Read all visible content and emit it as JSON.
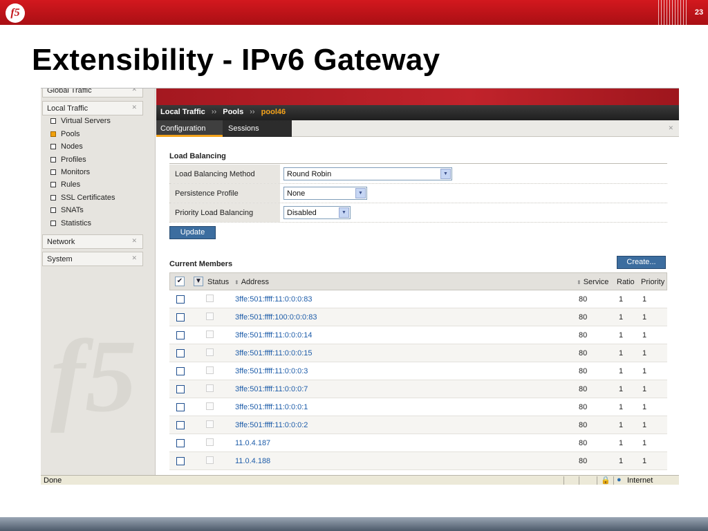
{
  "slide": {
    "logo": "f5",
    "number": "23",
    "title": "Extensibility - IPv6 Gateway"
  },
  "sidebar": {
    "sections": [
      {
        "label": "Global Traffic"
      },
      {
        "label": "Local Traffic"
      },
      {
        "label": "Network"
      },
      {
        "label": "System"
      }
    ],
    "local_traffic_items": [
      {
        "label": "Virtual Servers"
      },
      {
        "label": "Pools"
      },
      {
        "label": "Nodes"
      },
      {
        "label": "Profiles"
      },
      {
        "label": "Monitors"
      },
      {
        "label": "Rules"
      },
      {
        "label": "SSL Certificates"
      },
      {
        "label": "SNATs"
      },
      {
        "label": "Statistics"
      }
    ],
    "active_item": "Pools",
    "watermark": "f5"
  },
  "breadcrumb": {
    "items": [
      "Local Traffic",
      "Pools"
    ],
    "current": "pool46",
    "separator": "››"
  },
  "tabs": [
    {
      "label": "Configuration",
      "active": true
    },
    {
      "label": "Sessions",
      "active": false
    }
  ],
  "load_balancing": {
    "title": "Load Balancing",
    "fields": [
      {
        "label": "Load Balancing Method",
        "value": "Round Robin"
      },
      {
        "label": "Persistence Profile",
        "value": "None"
      },
      {
        "label": "Priority Load Balancing",
        "value": "Disabled"
      }
    ],
    "update_label": "Update"
  },
  "members": {
    "title": "Current Members",
    "create_label": "Create...",
    "columns": {
      "status": "Status",
      "address": "Address",
      "service": "Service",
      "ratio": "Ratio",
      "priority": "Priority"
    },
    "rows": [
      {
        "address": "3ffe:501:ffff:11:0:0:0:83",
        "service": "80",
        "ratio": "1",
        "priority": "1"
      },
      {
        "address": "3ffe:501:ffff:100:0:0:0:83",
        "service": "80",
        "ratio": "1",
        "priority": "1"
      },
      {
        "address": "3ffe:501:ffff:11:0:0:0:14",
        "service": "80",
        "ratio": "1",
        "priority": "1"
      },
      {
        "address": "3ffe:501:ffff:11:0:0:0:15",
        "service": "80",
        "ratio": "1",
        "priority": "1"
      },
      {
        "address": "3ffe:501:ffff:11:0:0:0:3",
        "service": "80",
        "ratio": "1",
        "priority": "1"
      },
      {
        "address": "3ffe:501:ffff:11:0:0:0:7",
        "service": "80",
        "ratio": "1",
        "priority": "1"
      },
      {
        "address": "3ffe:501:ffff:11:0:0:0:1",
        "service": "80",
        "ratio": "1",
        "priority": "1"
      },
      {
        "address": "3ffe:501:ffff:11:0:0:0:2",
        "service": "80",
        "ratio": "1",
        "priority": "1"
      },
      {
        "address": "11.0.4.187",
        "service": "80",
        "ratio": "1",
        "priority": "1"
      },
      {
        "address": "11.0.4.188",
        "service": "80",
        "ratio": "1",
        "priority": "1"
      }
    ]
  },
  "statusbar": {
    "left": "Done",
    "zone": "Internet"
  },
  "colors": {
    "brand_red": "#c4161c",
    "accent_orange": "#f3a21a",
    "link_blue": "#1d5ca9",
    "button_blue": "#3c6d9f"
  }
}
